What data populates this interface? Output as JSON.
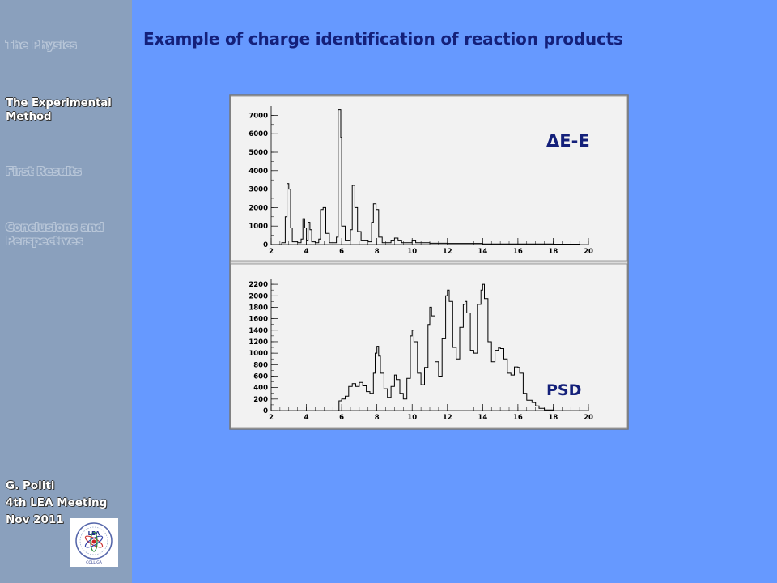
{
  "sidebar": {
    "items": [
      {
        "label": "The Physics",
        "active": false
      },
      {
        "label": "The Experimental Method",
        "active": true
      },
      {
        "label": "First Results",
        "active": false
      },
      {
        "label": "Conclusions and Perspectives",
        "active": false
      }
    ],
    "footer": [
      "G. Politi",
      "4th LEA Meeting",
      "Nov 2011"
    ],
    "logo": {
      "icon": "lea-colliga-logo",
      "text": "LEA",
      "subtext": "COLLIGA"
    }
  },
  "main": {
    "title": "Example of charge identification of reaction products"
  },
  "colors": {
    "background": "#6699ff",
    "sidebar": "#8aa0bd",
    "title": "#14207a",
    "panel": "#f2f2f2",
    "trace": "#000000"
  },
  "chart_data": [
    {
      "type": "line",
      "title": "",
      "label": "ΔE-E",
      "xlabel": "",
      "ylabel": "",
      "xlim": [
        2,
        20
      ],
      "ylim": [
        0,
        7500
      ],
      "x_ticks": [
        2,
        4,
        6,
        8,
        10,
        12,
        14,
        16,
        18,
        20
      ],
      "y_ticks": [
        0,
        1000,
        2000,
        3000,
        4000,
        5000,
        6000,
        7000
      ],
      "peaks": [
        {
          "x": 3.0,
          "y": 3300
        },
        {
          "x": 3.9,
          "y": 1400
        },
        {
          "x": 4.1,
          "y": 1100
        },
        {
          "x": 4.5,
          "y": 1000
        },
        {
          "x": 5.0,
          "y": 2000
        },
        {
          "x": 6.0,
          "y": 7300
        },
        {
          "x": 6.9,
          "y": 2000
        },
        {
          "x": 8.0,
          "y": 2100
        },
        {
          "x": 9.0,
          "y": 350
        },
        {
          "x": 10.0,
          "y": 200
        }
      ],
      "series": [
        {
          "values": [
            [
              2.4,
              0
            ],
            [
              2.6,
              100
            ],
            [
              2.8,
              1500
            ],
            [
              2.9,
              3300
            ],
            [
              3.0,
              3000
            ],
            [
              3.1,
              900
            ],
            [
              3.2,
              150
            ],
            [
              3.5,
              100
            ],
            [
              3.7,
              300
            ],
            [
              3.8,
              1400
            ],
            [
              3.9,
              900
            ],
            [
              4.0,
              200
            ],
            [
              4.1,
              1200
            ],
            [
              4.2,
              800
            ],
            [
              4.3,
              150
            ],
            [
              4.5,
              100
            ],
            [
              4.7,
              300
            ],
            [
              4.8,
              1900
            ],
            [
              4.95,
              2000
            ],
            [
              5.1,
              600
            ],
            [
              5.3,
              100
            ],
            [
              5.7,
              400
            ],
            [
              5.8,
              7300
            ],
            [
              5.95,
              5800
            ],
            [
              6.0,
              1000
            ],
            [
              6.2,
              200
            ],
            [
              6.5,
              800
            ],
            [
              6.6,
              3200
            ],
            [
              6.75,
              2000
            ],
            [
              6.9,
              700
            ],
            [
              7.1,
              200
            ],
            [
              7.5,
              150
            ],
            [
              7.7,
              1200
            ],
            [
              7.8,
              2200
            ],
            [
              7.95,
              1900
            ],
            [
              8.1,
              400
            ],
            [
              8.3,
              100
            ],
            [
              8.8,
              200
            ],
            [
              9.0,
              350
            ],
            [
              9.2,
              200
            ],
            [
              9.4,
              100
            ],
            [
              9.8,
              100
            ],
            [
              10.0,
              200
            ],
            [
              10.2,
              100
            ],
            [
              11.0,
              70
            ],
            [
              12.0,
              60
            ],
            [
              14.0,
              30
            ],
            [
              16.0,
              30
            ],
            [
              18.0,
              20
            ],
            [
              19.5,
              10
            ]
          ]
        }
      ]
    },
    {
      "type": "line",
      "title": "",
      "label": "PSD",
      "xlabel": "",
      "ylabel": "",
      "xlim": [
        2,
        20
      ],
      "ylim": [
        0,
        2300
      ],
      "x_ticks": [
        2,
        4,
        6,
        8,
        10,
        12,
        14,
        16,
        18,
        20
      ],
      "y_ticks": [
        0,
        200,
        400,
        600,
        800,
        1000,
        1200,
        1400,
        1600,
        1800,
        2000,
        2200
      ],
      "peaks": [
        {
          "x": 7.0,
          "y": 490
        },
        {
          "x": 8.0,
          "y": 1120
        },
        {
          "x": 9.0,
          "y": 620
        },
        {
          "x": 10.0,
          "y": 1400
        },
        {
          "x": 11.0,
          "y": 1800
        },
        {
          "x": 12.0,
          "y": 2100
        },
        {
          "x": 13.0,
          "y": 1900
        },
        {
          "x": 14.0,
          "y": 2200
        },
        {
          "x": 15.0,
          "y": 1100
        },
        {
          "x": 16.0,
          "y": 750
        }
      ],
      "series": [
        {
          "values": [
            [
              5.8,
              0
            ],
            [
              5.85,
              170
            ],
            [
              6.0,
              200
            ],
            [
              6.2,
              250
            ],
            [
              6.4,
              420
            ],
            [
              6.6,
              470
            ],
            [
              6.8,
              420
            ],
            [
              7.0,
              490
            ],
            [
              7.2,
              430
            ],
            [
              7.4,
              330
            ],
            [
              7.6,
              300
            ],
            [
              7.8,
              650
            ],
            [
              7.9,
              1000
            ],
            [
              8.0,
              1120
            ],
            [
              8.1,
              950
            ],
            [
              8.2,
              650
            ],
            [
              8.4,
              380
            ],
            [
              8.6,
              230
            ],
            [
              8.8,
              420
            ],
            [
              9.0,
              620
            ],
            [
              9.1,
              540
            ],
            [
              9.3,
              300
            ],
            [
              9.5,
              200
            ],
            [
              9.7,
              560
            ],
            [
              9.9,
              1300
            ],
            [
              10.0,
              1400
            ],
            [
              10.1,
              1200
            ],
            [
              10.3,
              650
            ],
            [
              10.5,
              450
            ],
            [
              10.7,
              750
            ],
            [
              10.9,
              1500
            ],
            [
              11.0,
              1800
            ],
            [
              11.1,
              1650
            ],
            [
              11.3,
              850
            ],
            [
              11.5,
              600
            ],
            [
              11.7,
              1250
            ],
            [
              11.9,
              2000
            ],
            [
              12.0,
              2100
            ],
            [
              12.1,
              1900
            ],
            [
              12.3,
              1100
            ],
            [
              12.5,
              900
            ],
            [
              12.7,
              1450
            ],
            [
              12.9,
              1850
            ],
            [
              13.0,
              1900
            ],
            [
              13.1,
              1700
            ],
            [
              13.3,
              1050
            ],
            [
              13.5,
              1000
            ],
            [
              13.7,
              1850
            ],
            [
              13.9,
              2100
            ],
            [
              14.0,
              2200
            ],
            [
              14.1,
              1950
            ],
            [
              14.3,
              1200
            ],
            [
              14.5,
              850
            ],
            [
              14.7,
              1050
            ],
            [
              14.9,
              1100
            ],
            [
              15.0,
              1080
            ],
            [
              15.2,
              900
            ],
            [
              15.4,
              650
            ],
            [
              15.6,
              620
            ],
            [
              15.8,
              760
            ],
            [
              16.0,
              750
            ],
            [
              16.1,
              650
            ],
            [
              16.3,
              300
            ],
            [
              16.5,
              180
            ],
            [
              16.8,
              140
            ],
            [
              17.0,
              80
            ],
            [
              17.2,
              40
            ],
            [
              17.5,
              10
            ],
            [
              18.0,
              0
            ]
          ]
        }
      ]
    }
  ]
}
